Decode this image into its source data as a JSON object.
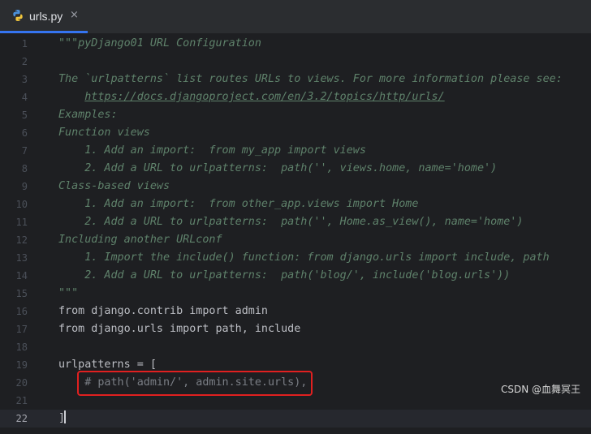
{
  "tab": {
    "filename": "urls.py",
    "close_glyph": "×",
    "icon": "python-file-icon"
  },
  "lines": [
    {
      "n": "1",
      "t": "\"\"\"pyDjango01 URL Configuration",
      "cls": "doc"
    },
    {
      "n": "2",
      "t": "",
      "cls": "doc"
    },
    {
      "n": "3",
      "t": "The `urlpatterns` list routes URLs to views. For more information please see:",
      "cls": "doc"
    },
    {
      "n": "4",
      "t": "https://docs.djangoproject.com/en/3.2/topics/http/urls/",
      "cls": "link",
      "indent": "    "
    },
    {
      "n": "5",
      "t": "Examples:",
      "cls": "doc"
    },
    {
      "n": "6",
      "t": "Function views",
      "cls": "doc"
    },
    {
      "n": "7",
      "t": "    1. Add an import:  from my_app import views",
      "cls": "doc"
    },
    {
      "n": "8",
      "t": "    2. Add a URL to urlpatterns:  path('', views.home, name='home')",
      "cls": "doc"
    },
    {
      "n": "9",
      "t": "Class-based views",
      "cls": "doc"
    },
    {
      "n": "10",
      "t": "    1. Add an import:  from other_app.views import Home",
      "cls": "doc"
    },
    {
      "n": "11",
      "t": "    2. Add a URL to urlpatterns:  path('', Home.as_view(), name='home')",
      "cls": "doc"
    },
    {
      "n": "12",
      "t": "Including another URLconf",
      "cls": "doc"
    },
    {
      "n": "13",
      "t": "    1. Import the include() function: from django.urls import include, path",
      "cls": "doc"
    },
    {
      "n": "14",
      "t": "    2. Add a URL to urlpatterns:  path('blog/', include('blog.urls'))",
      "cls": "doc"
    },
    {
      "n": "15",
      "t": "\"\"\"",
      "cls": "doc"
    },
    {
      "n": "16",
      "t": "from django.contrib import admin",
      "cls": "plain"
    },
    {
      "n": "17",
      "t": "from django.urls import path, include",
      "cls": "plain"
    },
    {
      "n": "18",
      "t": "",
      "cls": "plain"
    },
    {
      "n": "19",
      "t": "urlpatterns = [",
      "cls": "plain"
    },
    {
      "n": "20",
      "t": "    # path('admin/', admin.site.urls),",
      "cls": "cmt"
    },
    {
      "n": "21",
      "t": "",
      "cls": "plain"
    },
    {
      "n": "22",
      "t": "]",
      "cls": "plain",
      "current": true
    }
  ],
  "watermark": "CSDN @血舞冥王",
  "colors": {
    "accent": "#3574f0",
    "docstring": "#5f826b",
    "highlight_border": "#e02020"
  }
}
